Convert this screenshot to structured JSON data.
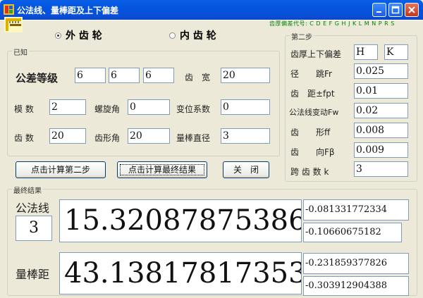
{
  "window": {
    "title": "公法线、量棒距及上下偏差"
  },
  "codes_hint": "齿厚偏差代号: C D E F G H J K L M N P R S",
  "gear_type": {
    "external_label": "外 齿 轮",
    "internal_label": "内 齿 轮",
    "selected": "external"
  },
  "known": {
    "legend": "已知",
    "tolerance_label": "公差等级",
    "tolerance_values": [
      "6",
      "6",
      "6"
    ],
    "face_width_label": "齿　宽",
    "face_width": "20",
    "module_label": "模 数",
    "module": "2",
    "helix_label": "螺旋角",
    "helix": "0",
    "shift_label": "变位系数",
    "shift": "0",
    "teeth_label": "齿 数",
    "teeth": "20",
    "pressure_label": "齿形角",
    "pressure": "20",
    "rod_label": "量棒直径",
    "rod": "3"
  },
  "step2": {
    "legend": "第二步",
    "dev_label": "齿厚上下偏差",
    "dev_upper": "H",
    "dev_lower": "K",
    "radial_label": "径　　跳Fr",
    "radial": "0.025",
    "pitch_label": "齿　距±fpt",
    "pitch": "0.01",
    "wvar_label": "公法线变动Fw",
    "wvar": "0.02",
    "profile_label": "齿　　形ff",
    "profile": "0.008",
    "lead_label": "齿　　向Fβ",
    "lead": "0.009",
    "span_label": "跨 齿 数 k",
    "span": "3"
  },
  "buttons": {
    "step2": "点击计算第二步",
    "final": "点击计算最终结果",
    "close": "关　闭"
  },
  "results": {
    "legend": "最终结果",
    "w_label": "公法线",
    "w_k": "3",
    "w_value": "15.32087875386",
    "w_upper": "-0.081331772334",
    "w_lower": "-0.10660675182",
    "m_label": "量棒距",
    "m_value": "43.13817817353",
    "m_upper": "-0.231859377826",
    "m_lower": "-0.303912904388"
  }
}
